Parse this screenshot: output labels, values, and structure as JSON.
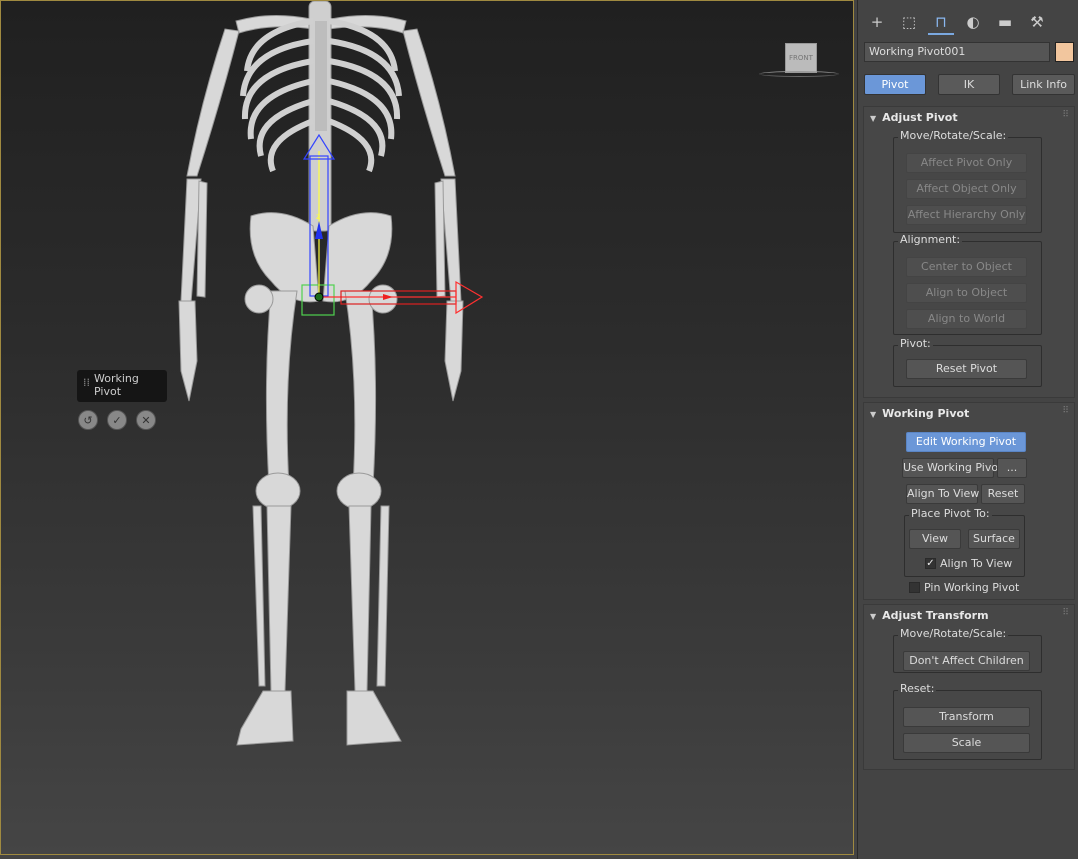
{
  "viewport": {
    "viewcube_label": "FRONT",
    "gizmo_axis_label": "z"
  },
  "hud": {
    "title": "Working Pivot",
    "buttons": [
      {
        "name": "undo-icon"
      },
      {
        "name": "checkmark-icon"
      },
      {
        "name": "close-icon"
      }
    ]
  },
  "panel": {
    "tabs": [
      "create-icon",
      "modify-icon",
      "hierarchy-icon",
      "motion-icon",
      "display-icon",
      "utilities-icon"
    ],
    "active_tab": "hierarchy-icon",
    "object_name": "Working Pivot001",
    "swatch_color": "#f2c69e",
    "mode_buttons": {
      "pivot": "Pivot",
      "ik": "IK",
      "link_info": "Link Info"
    },
    "adjust_pivot": {
      "title": "Adjust Pivot",
      "move_group": "Move/Rotate/Scale:",
      "affect_pivot_only": "Affect Pivot Only",
      "affect_object_only": "Affect Object Only",
      "affect_hierarchy_only": "Affect Hierarchy Only",
      "alignment_group": "Alignment:",
      "center_to_object": "Center to Object",
      "align_to_object": "Align to Object",
      "align_to_world": "Align to World",
      "pivot_group": "Pivot:",
      "reset_pivot": "Reset Pivot"
    },
    "working_pivot": {
      "title": "Working Pivot",
      "edit_working_pivot": "Edit Working Pivot",
      "use_working_pivot": "Use Working Pivot",
      "ellipsis": "...",
      "align_to_view": "Align To View",
      "reset": "Reset",
      "place_group": "Place Pivot To:",
      "view": "View",
      "surface": "Surface",
      "align_to_view_check": "Align To View",
      "align_to_view_checked": true,
      "pin_working_pivot": "Pin Working Pivot",
      "pin_checked": false
    },
    "adjust_transform": {
      "title": "Adjust Transform",
      "move_group": "Move/Rotate/Scale:",
      "dont_affect_children": "Don't Affect Children",
      "reset_group": "Reset:",
      "transform": "Transform",
      "scale": "Scale"
    }
  }
}
